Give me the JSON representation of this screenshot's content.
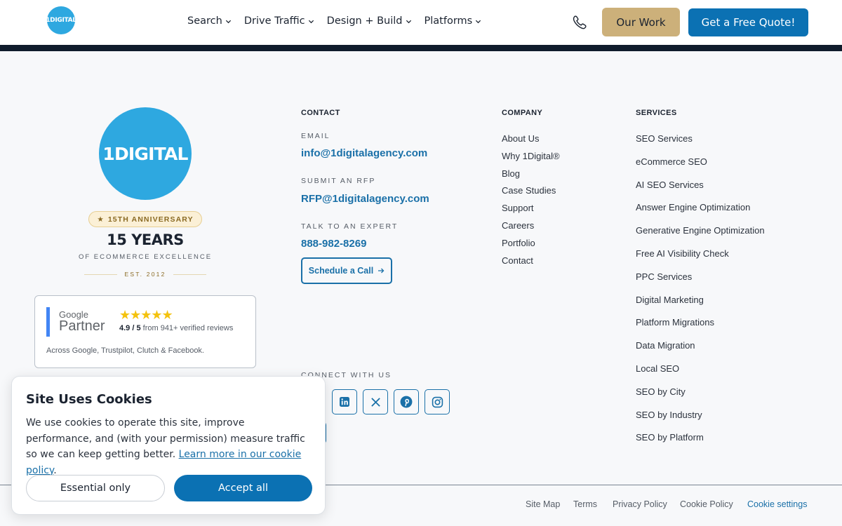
{
  "header": {
    "logo_text": "1DIGITAL",
    "nav": [
      {
        "label": "Search"
      },
      {
        "label": "Drive Traffic"
      },
      {
        "label": "Design + Build"
      },
      {
        "label": "Platforms"
      }
    ],
    "our_work_label": "Our Work",
    "quote_label": "Get a Free Quote!"
  },
  "brand": {
    "logo_text": "1DIGITAL",
    "anniversary_badge": "15TH ANNIVERSARY",
    "years_title": "15 YEARS",
    "years_subtitle": "OF ECOMMERCE EXCELLENCE",
    "established": "EST. 2012"
  },
  "partner": {
    "google_word": "Google",
    "partner_word": "Partner",
    "stars": "★★★★★",
    "rating": "4.9 / 5",
    "reviews_text": "from 941+ verified reviews",
    "footnote": "Across Google, Trustpilot, Clutch & Facebook."
  },
  "contact": {
    "heading": "CONTACT",
    "email_label": "EMAIL",
    "email": "info@1digitalagency.com",
    "rfp_label": "SUBMIT AN RFP",
    "rfp_email": "RFP@1digitalagency.com",
    "expert_label": "TALK TO AN EXPERT",
    "phone": "888-982-8269",
    "schedule_label": "Schedule a Call",
    "connect_label": "CONNECT WITH US",
    "social": [
      "linkedin-icon",
      "x-icon",
      "pinterest-icon",
      "instagram-icon"
    ]
  },
  "company": {
    "heading": "COMPANY",
    "links": [
      "About Us",
      "Why 1Digital®",
      "Blog",
      "Case Studies",
      "Support",
      "Careers",
      "Portfolio",
      "Contact"
    ]
  },
  "services": {
    "heading": "SERVICES",
    "links": [
      "SEO Services",
      "eCommerce SEO",
      "AI SEO Services",
      "Answer Engine Optimization",
      "Generative Engine Optimization",
      "Free AI Visibility Check",
      "PPC Services",
      "Digital Marketing",
      "Platform Migrations",
      "Data Migration",
      "Local SEO",
      "SEO by City",
      "SEO by Industry",
      "SEO by Platform"
    ]
  },
  "footer": {
    "links": [
      "Site Map",
      "Terms",
      "Privacy Policy",
      "Cookie Policy",
      "Cookie settings"
    ]
  },
  "cookie": {
    "title": "Site Uses Cookies",
    "body": "We use cookies to operate this site, improve performance, and (with your permission) measure traffic so we can keep getting better.",
    "link_text": "Learn more in our cookie policy",
    "link_suffix": ".",
    "essential_label": "Essential only",
    "accept_label": "Accept all"
  },
  "colors": {
    "brand_blue": "#2ea8e0",
    "primary_button": "#0b71b3",
    "our_work_button": "#ccb07a",
    "link_blue": "#1a70a8",
    "header_band": "#101c2c"
  }
}
